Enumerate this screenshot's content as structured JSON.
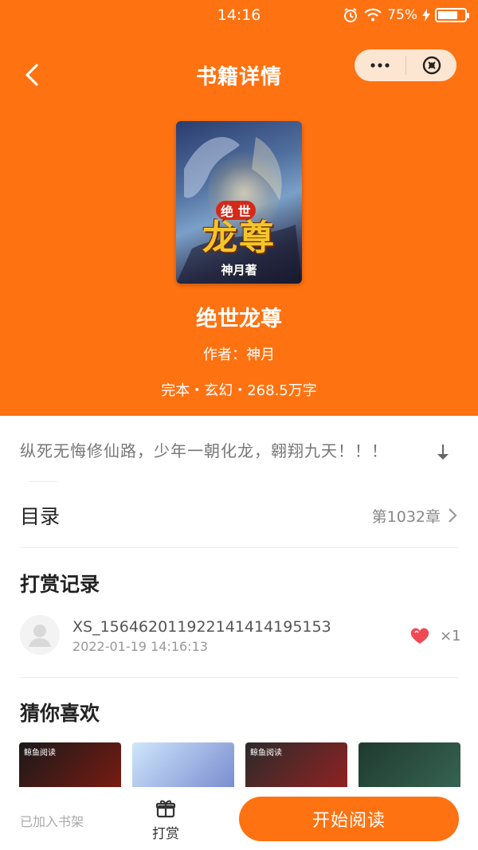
{
  "status_bar": {
    "time": "14:16",
    "battery": "75%",
    "battery_level": 0.75
  },
  "nav": {
    "title": "书籍详情",
    "back_icon": "chevron-left-icon",
    "more_icon": "more-dots-icon",
    "close_icon": "close-circle-icon"
  },
  "book": {
    "cover_badge": "绝 世",
    "cover_title": "龙尊",
    "cover_author": "神月著",
    "title": "绝世龙尊",
    "author": "作者：神月",
    "meta": "完本・玄幻・268.5万字",
    "synopsis": "纵死无悔修仙路，少年一朝化龙，翱翔九天！！！"
  },
  "toc": {
    "label": "目录",
    "chapter": "第1032章"
  },
  "rewards": {
    "title": "打赏记录",
    "records": [
      {
        "user": "XS_156462011922141414195153",
        "time": "2022-01-19 14:16:13",
        "count": "×1"
      }
    ]
  },
  "recommend": {
    "title": "猜你喜欢",
    "items": [
      {
        "tag": "鲸鱼阅读",
        "color_a": "#1a1a1a",
        "color_b": "#8a1b10"
      },
      {
        "tag": "",
        "color_a": "#cfe6fb",
        "color_b": "#6a7cc8"
      },
      {
        "tag": "鲸鱼阅读",
        "color_a": "#2b2b2b",
        "color_b": "#a32020"
      },
      {
        "tag": "",
        "color_a": "#1f3a2e",
        "color_b": "#3a6b58"
      }
    ]
  },
  "bottom": {
    "shelf": "已加入书架",
    "reward": "打赏",
    "read": "开始阅读"
  },
  "colors": {
    "accent": "#ff7211"
  }
}
